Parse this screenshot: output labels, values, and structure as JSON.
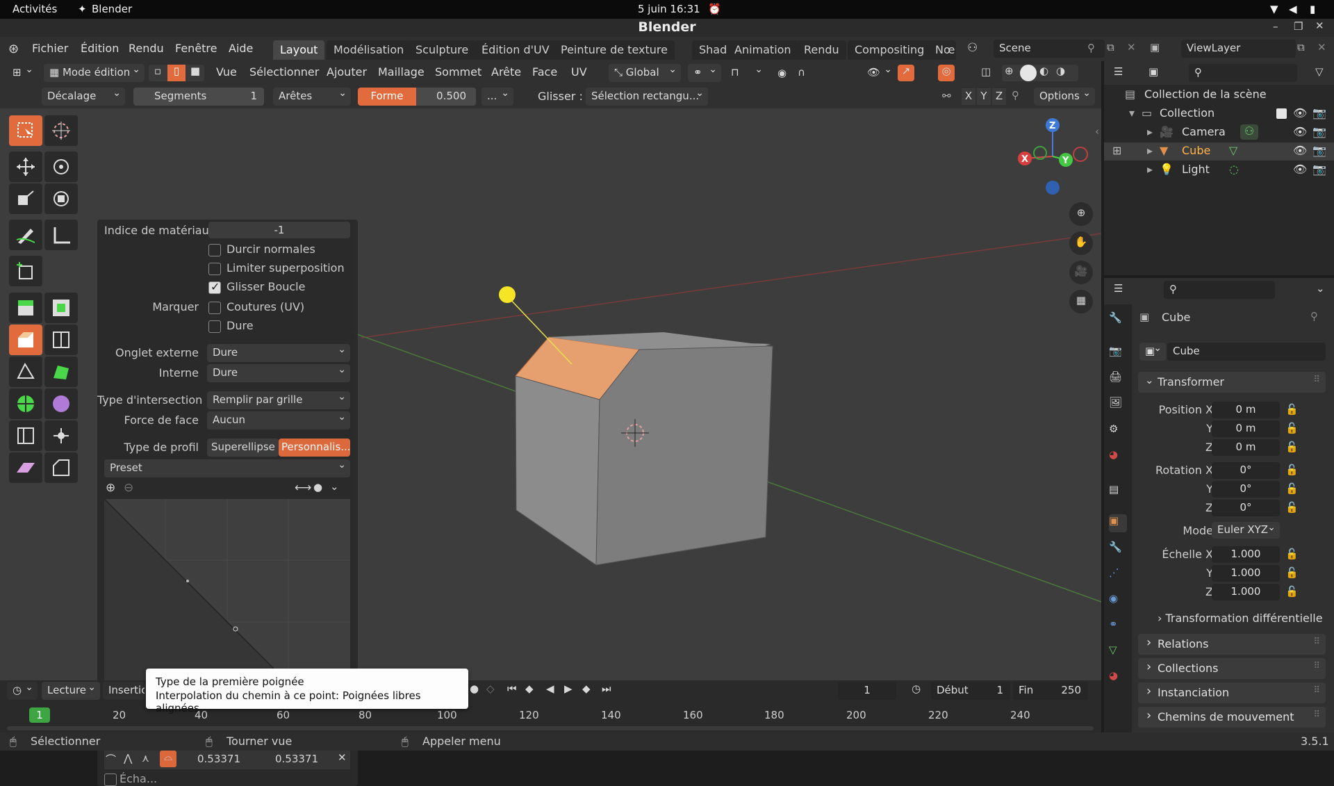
{
  "gnome": {
    "activities": "Activités",
    "app": "Blender",
    "clock": "5 juin  16:31"
  },
  "window": {
    "title": "Blender"
  },
  "menu": {
    "items": [
      "Fichier",
      "Édition",
      "Rendu",
      "Fenêtre",
      "Aide"
    ],
    "workspaces": [
      "Layout",
      "Modélisation",
      "Sculpture",
      "Édition d'UV",
      "Peinture de texture",
      "Shading",
      "Animation",
      "Rendu",
      "Compositing",
      "Nœ"
    ],
    "scene": "Scene",
    "view_layer": "ViewLayer"
  },
  "header": {
    "mode": "Mode édition",
    "menus": [
      "Vue",
      "Sélectionner",
      "Ajouter",
      "Maillage",
      "Sommet",
      "Arête",
      "Face",
      "UV"
    ],
    "orientation": "Global"
  },
  "bevel_header": {
    "type": "Décalage",
    "segments_label": "Segments",
    "segments_value": "1",
    "affect": "Arêtes",
    "shape_label": "Forme",
    "shape_value": "0.500",
    "more": "...",
    "slide_label": "Glisser :",
    "select_mode": "Sélection rectangu...",
    "axes": [
      "X",
      "Y",
      "Z"
    ],
    "options": "Options"
  },
  "operator": {
    "material_label": "Indice de matériau",
    "material_value": "-1",
    "harden": "Durcir normales",
    "clamp": "Limiter superposition",
    "loop_slide": "Glisser Boucle",
    "mark_label": "Marquer",
    "seams": "Coutures (UV)",
    "sharp": "Dure",
    "miter_outer_label": "Onglet externe",
    "miter_outer": "Dure",
    "miter_inner_label": "Interne",
    "miter_inner": "Dure",
    "intersection_label": "Type d'intersection",
    "intersection": "Remplir par grille",
    "face_strength_label": "Force de face",
    "face_strength": "Aucun",
    "profile_label": "Type de profil",
    "profile_superellipse": "Superellipse",
    "profile_custom": "Personnalis...",
    "preset": "Preset",
    "handle_x": "0.53371",
    "handle_y": "0.53371",
    "sample": "Écha..."
  },
  "tooltip": {
    "line1": "Type de la première poignée",
    "line2_label": "Interpolation du chemin à ce point:",
    "line2_value": "Poignées libres alignées"
  },
  "outliner": {
    "scene_collection": "Collection de la scène",
    "collection": "Collection",
    "items": [
      "Camera",
      "Cube",
      "Light"
    ]
  },
  "properties": {
    "object_name": "Cube",
    "data_name": "Cube",
    "transform": "Transformer",
    "position_label": "Position X",
    "position": [
      "0 m",
      "0 m",
      "0 m"
    ],
    "rotation_label": "Rotation X",
    "rotation": [
      "0°",
      "0°",
      "0°"
    ],
    "mode_label": "Mode",
    "mode": "Euler XYZ",
    "scale_label": "Échelle X",
    "scale": [
      "1.000",
      "1.000",
      "1.000"
    ],
    "axis_y": "Y",
    "axis_z": "Z",
    "delta": "Transformation différentielle",
    "sections": [
      "Relations",
      "Collections",
      "Instanciation",
      "Chemins de mouvement"
    ]
  },
  "timeline": {
    "playback": "Lecture",
    "keying": "Insertio",
    "current_frame": "1",
    "start_label": "Début",
    "start": "1",
    "end_label": "Fin",
    "end": "250",
    "ticks": [
      "20",
      "40",
      "60",
      "80",
      "100",
      "120",
      "140",
      "160",
      "180",
      "200",
      "220",
      "240"
    ],
    "playhead": "1"
  },
  "status": {
    "select": "Sélectionner",
    "rotate": "Tourner vue",
    "menu": "Appeler menu",
    "version": "3.5.1"
  },
  "gizmo": {
    "x": "X",
    "y": "Y",
    "z": "Z"
  },
  "colors": {
    "accent": "#e16b3c",
    "active_tab": "#474747",
    "selection": "#f0a04b"
  }
}
